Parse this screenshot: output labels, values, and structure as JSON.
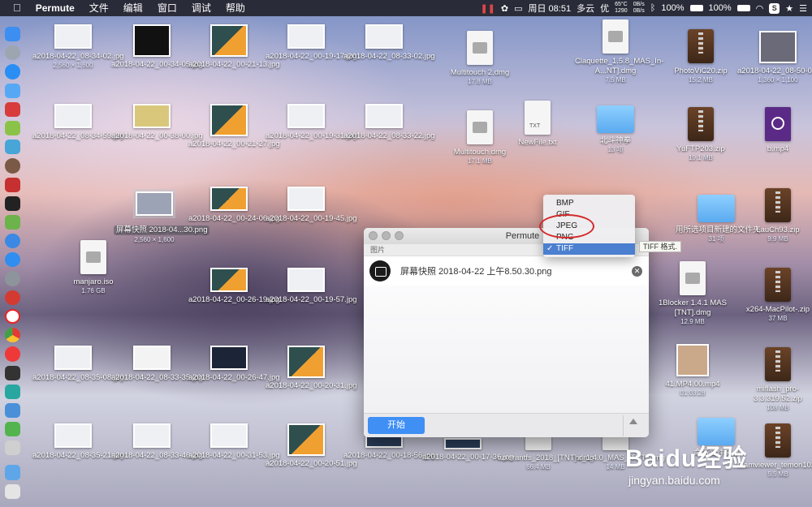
{
  "menubar": {
    "apple": "",
    "app": "Permute",
    "menus": [
      "文件",
      "编辑",
      "窗口",
      "调试",
      "帮助"
    ],
    "status": {
      "temp": "65°C",
      "rpm": "1290",
      "up": "0B/s",
      "down": "0B/s",
      "battery1": "100%",
      "battery2": "100%",
      "clock": "周日 08:51",
      "weather": "多云",
      "extra": "优"
    }
  },
  "desktop": {
    "items": [
      {
        "name": "a2018-04-22_08-34-02.jpg",
        "sub": "2,560 × 1,600"
      },
      {
        "name": "a2018-04-22_00-34-05.jpg",
        "sub": ""
      },
      {
        "name": "a2018-04-22_00-21-13.jpg",
        "sub": ""
      },
      {
        "name": "a2018-04-22_00-19-17.jpg",
        "sub": ""
      },
      {
        "name": "a2018-04-22_08-33-02.jpg",
        "sub": ""
      },
      {
        "name": "Multitouch 2.dmg",
        "sub": "17.8 MB"
      },
      {
        "name": "Claquette_1.5.8_MAS_In-A...NT].dmg",
        "sub": "7.5 MB"
      },
      {
        "name": "PhotoViC20.zip",
        "sub": "15.2 MB"
      },
      {
        "name": "a2018-04-22_08-50-03.png",
        "sub": "1,360 × 1,100"
      },
      {
        "name": "a2018-04-22_08-34-59.jpg",
        "sub": ""
      },
      {
        "name": "a2018-04-22_00-38-00.jpg",
        "sub": ""
      },
      {
        "name": "a2018-04-22_00-21-27.jpg",
        "sub": ""
      },
      {
        "name": "a2018-04-22_00-19-31.jpg",
        "sub": ""
      },
      {
        "name": "a2018-04-22_08-33-22.jpg",
        "sub": ""
      },
      {
        "name": "Multitouch.dmg",
        "sub": "17.1 MB"
      },
      {
        "name": "NewFile.txt",
        "sub": ""
      },
      {
        "name": "北斗神拳",
        "sub": "13 项"
      },
      {
        "name": "YuFTP203.zip",
        "sub": "19.1 MB"
      },
      {
        "name": "b.mp4",
        "sub": ""
      },
      {
        "name": "屏幕快照 2018-04...30.png",
        "sub": "2,560 × 1,600"
      },
      {
        "name": "a2018-04-22_00-24-06.jpg",
        "sub": ""
      },
      {
        "name": "a2018-04-22_00-19-45.jpg",
        "sub": ""
      },
      {
        "name": "用所选项目新建的文件夹",
        "sub": "31 项"
      },
      {
        "name": "LauCh93.zip",
        "sub": "9.9 MB"
      },
      {
        "name": "manjaro.iso",
        "sub": "1.76 GB"
      },
      {
        "name": "a2018-04-22_00-26-19.jpg",
        "sub": ""
      },
      {
        "name": "a2018-04-22_00-19-57.jpg",
        "sub": ""
      },
      {
        "name": "1Blocker 1.4.1 MAS [TNT].dmg",
        "sub": "12.9 MB"
      },
      {
        "name": "x264-MacPilot-.zip",
        "sub": "37 MB"
      },
      {
        "name": "a2018-04-22_08-35-08.jpg",
        "sub": ""
      },
      {
        "name": "a2018-04-22_08-33-35.jpg",
        "sub": ""
      },
      {
        "name": "a2018-04-22_00-26-47.jpg",
        "sub": ""
      },
      {
        "name": "a2018-04-22_00-20-31.jpg",
        "sub": ""
      },
      {
        "name": "41.MP4.00.mp4",
        "sub": "01:03:28"
      },
      {
        "name": "miflash_pro-3.3.319.52.zip",
        "sub": "108 MB"
      },
      {
        "name": "a2018-04-22_08-35-21.jpg",
        "sub": ""
      },
      {
        "name": "a2018-04-22_08-33-46.jpg",
        "sub": ""
      },
      {
        "name": "a2018-04-22_00-31-53.jpg",
        "sub": ""
      },
      {
        "name": "a2018-04-22_00-20-51.jpg",
        "sub": ""
      },
      {
        "name": "a2018-04-22_00-18-56.jpg",
        "sub": ""
      },
      {
        "name": "a2018-04-22_00-17-36.jpg",
        "sub": ""
      },
      {
        "name": "tuxerantfs_2018_[TNT].dmg",
        "sub": "66.4 MB"
      },
      {
        "name": "hr_1.4.0_MAS_[TNT].dmg",
        "sub": "14 MB"
      },
      {
        "name": "命名文件夹 2",
        "sub": ""
      },
      {
        "name": "teamviewer_temon102.zip",
        "sub": "5.5 MB"
      }
    ]
  },
  "window": {
    "title": "Permute",
    "section": "图片",
    "file": "屏幕快照 2018-04-22 上午8.50.30.png",
    "start": "开始"
  },
  "dropdown": {
    "options": [
      "BMP",
      "GIF",
      "JPEG",
      "PNG",
      "TIFF"
    ],
    "selected": "TIFF",
    "check": "✓"
  },
  "tooltip": "TIFF 格式.",
  "watermark": {
    "brand": "Baidu经验",
    "url": "jingyan.baidu.com"
  }
}
